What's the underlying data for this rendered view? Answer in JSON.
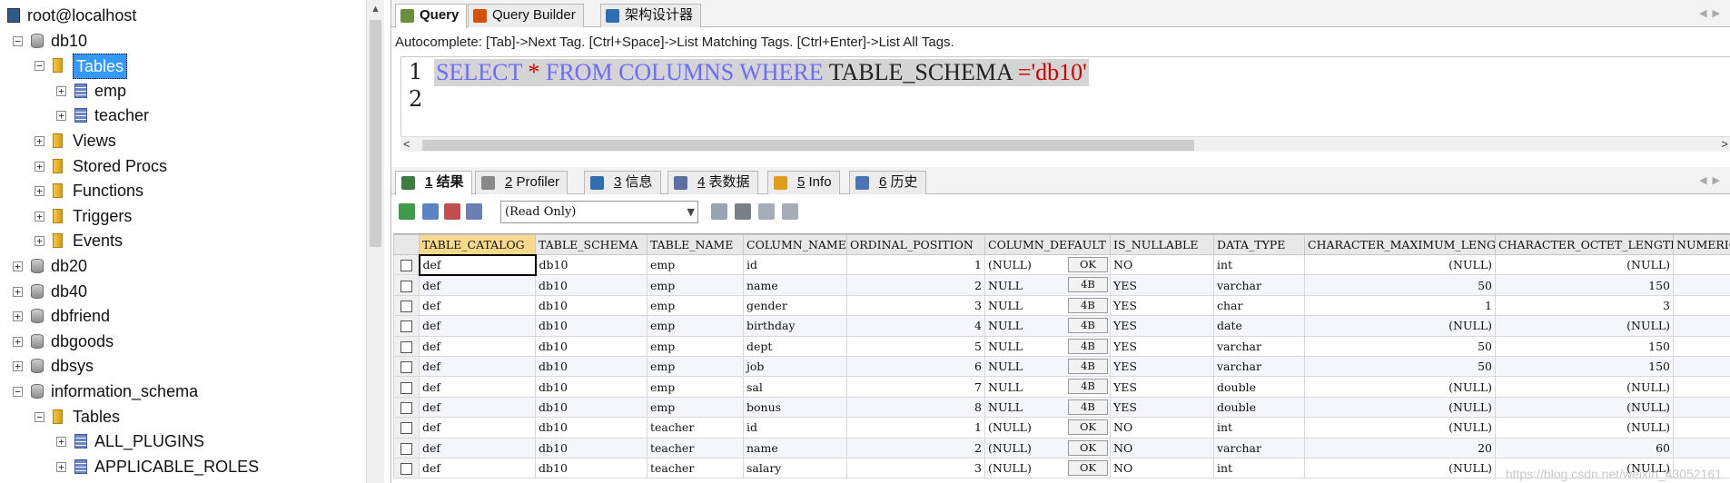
{
  "tree": {
    "items": [
      {
        "label": "root@localhost",
        "level": 0,
        "type": "host",
        "expander": ""
      },
      {
        "label": "db10",
        "level": 0,
        "type": "db",
        "expander": "−"
      },
      {
        "label": "Tables",
        "level": 1,
        "type": "folder",
        "expander": "−",
        "selected": true
      },
      {
        "label": "emp",
        "level": 2,
        "type": "table",
        "expander": "+"
      },
      {
        "label": "teacher",
        "level": 2,
        "type": "table",
        "expander": "+"
      },
      {
        "label": "Views",
        "level": 1,
        "type": "folder",
        "expander": "+"
      },
      {
        "label": "Stored Procs",
        "level": 1,
        "type": "folder",
        "expander": "+"
      },
      {
        "label": "Functions",
        "level": 1,
        "type": "folder",
        "expander": "+"
      },
      {
        "label": "Triggers",
        "level": 1,
        "type": "folder",
        "expander": "+"
      },
      {
        "label": "Events",
        "level": 1,
        "type": "folder",
        "expander": "+"
      },
      {
        "label": "db20",
        "level": 0,
        "type": "db",
        "expander": "+"
      },
      {
        "label": "db40",
        "level": 0,
        "type": "db",
        "expander": "+"
      },
      {
        "label": "dbfriend",
        "level": 0,
        "type": "db",
        "expander": "+"
      },
      {
        "label": "dbgoods",
        "level": 0,
        "type": "db",
        "expander": "+"
      },
      {
        "label": "dbsys",
        "level": 0,
        "type": "db",
        "expander": "+"
      },
      {
        "label": "information_schema",
        "level": 0,
        "type": "db",
        "expander": "−"
      },
      {
        "label": "Tables",
        "level": 1,
        "type": "folder",
        "expander": "−"
      },
      {
        "label": "ALL_PLUGINS",
        "level": 2,
        "type": "table",
        "expander": "+"
      },
      {
        "label": "APPLICABLE_ROLES",
        "level": 2,
        "type": "table",
        "expander": "+"
      }
    ]
  },
  "editor_tabs": [
    {
      "label": "Query",
      "active": true,
      "icon": "query-icon"
    },
    {
      "label": "Query Builder",
      "active": false,
      "icon": "query-builder-icon"
    },
    {
      "label": "架构设计器",
      "active": false,
      "icon": "schema-designer-icon"
    }
  ],
  "autocomplete_hint": "Autocomplete: [Tab]->Next Tag. [Ctrl+Space]->List Matching Tags. [Ctrl+Enter]->List All Tags.",
  "editor": {
    "line_numbers": [
      "1",
      "2"
    ],
    "sql": {
      "kw1": "SELECT",
      "star": "*",
      "kw2": "FROM",
      "kw3": "COLUMNS",
      "kw4": "WHERE",
      "col": "TABLE_SCHEMA",
      "eq": "=",
      "str": "'db10'"
    }
  },
  "result_tabs": [
    {
      "num": "1",
      "label": "结果",
      "active": true,
      "icon": "results-icon"
    },
    {
      "num": "2",
      "label": "Profiler",
      "active": false,
      "icon": "profiler-icon"
    },
    {
      "num": "3",
      "label": "信息",
      "active": false,
      "icon": "info-icon"
    },
    {
      "num": "4",
      "label": "表数据",
      "active": false,
      "icon": "table-data-icon"
    },
    {
      "num": "5",
      "label": "Info",
      "active": false,
      "icon": "info-chart-icon"
    },
    {
      "num": "6",
      "label": "历史",
      "active": false,
      "icon": "history-icon"
    }
  ],
  "result_toolbar": {
    "mode_select": "(Read Only)"
  },
  "grid": {
    "columns": [
      "TABLE_CATALOG",
      "TABLE_SCHEMA",
      "TABLE_NAME",
      "COLUMN_NAME",
      "ORDINAL_POSITION",
      "COLUMN_DEFAULT",
      "IS_NULLABLE",
      "DATA_TYPE",
      "CHARACTER_MAXIMUM_LENGTH",
      "CHARACTER_OCTET_LENGTH",
      "NUMERIC_"
    ],
    "rows": [
      [
        "def",
        "db10",
        "emp",
        "id",
        "1",
        "(NULL)",
        "OK",
        "NO",
        "int",
        "(NULL)",
        "(NULL)"
      ],
      [
        "def",
        "db10",
        "emp",
        "name",
        "2",
        "NULL",
        "4B",
        "YES",
        "varchar",
        "50",
        "150"
      ],
      [
        "def",
        "db10",
        "emp",
        "gender",
        "3",
        "NULL",
        "4B",
        "YES",
        "char",
        "1",
        "3"
      ],
      [
        "def",
        "db10",
        "emp",
        "birthday",
        "4",
        "NULL",
        "4B",
        "YES",
        "date",
        "(NULL)",
        "(NULL)"
      ],
      [
        "def",
        "db10",
        "emp",
        "dept",
        "5",
        "NULL",
        "4B",
        "YES",
        "varchar",
        "50",
        "150"
      ],
      [
        "def",
        "db10",
        "emp",
        "job",
        "6",
        "NULL",
        "4B",
        "YES",
        "varchar",
        "50",
        "150"
      ],
      [
        "def",
        "db10",
        "emp",
        "sal",
        "7",
        "NULL",
        "4B",
        "YES",
        "double",
        "(NULL)",
        "(NULL)"
      ],
      [
        "def",
        "db10",
        "emp",
        "bonus",
        "8",
        "NULL",
        "4B",
        "YES",
        "double",
        "(NULL)",
        "(NULL)"
      ],
      [
        "def",
        "db10",
        "teacher",
        "id",
        "1",
        "(NULL)",
        "OK",
        "NO",
        "int",
        "(NULL)",
        "(NULL)"
      ],
      [
        "def",
        "db10",
        "teacher",
        "name",
        "2",
        "(NULL)",
        "OK",
        "NO",
        "varchar",
        "20",
        "60"
      ],
      [
        "def",
        "db10",
        "teacher",
        "salary",
        "3",
        "(NULL)",
        "OK",
        "NO",
        "int",
        "(NULL)",
        "(NULL)"
      ]
    ]
  },
  "watermark": "https://blog.csdn.net/weixin_43052161"
}
